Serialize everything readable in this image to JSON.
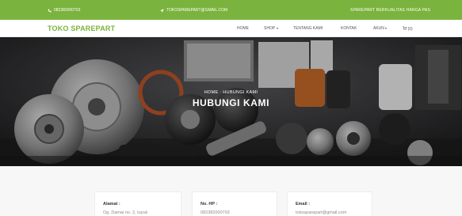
{
  "topbar": {
    "phone": "082382000703",
    "phone_icon": "phone-icon",
    "email": "TOKOSPAREPART@GMAIL.COM",
    "email_icon": "send-icon",
    "slogan": "SPAREPART BERKUALITAS HARGA PAS",
    "background": "#7ab33d"
  },
  "navbar": {
    "brand": "TOKO SPAREPART",
    "brand_color": "#7ab33d",
    "items": {
      "home": "HOME",
      "shop": "SHOP",
      "about": "TENTANG KAMI",
      "contact": "KONTAK",
      "account": "AKUN",
      "cart_count": "(0)"
    }
  },
  "hero": {
    "breadcrumb": "HOME · HUBUNGI KAMI",
    "title": "HUBUNGI KAMI"
  },
  "contact": {
    "address": {
      "label": "Alamat :",
      "value": "Og. Damai no. 2, tuyuk"
    },
    "phone": {
      "label": "No. HP :",
      "value": "082382000703"
    },
    "email": {
      "label": "Email :",
      "value": "tokosparepart@gmail.com"
    }
  }
}
